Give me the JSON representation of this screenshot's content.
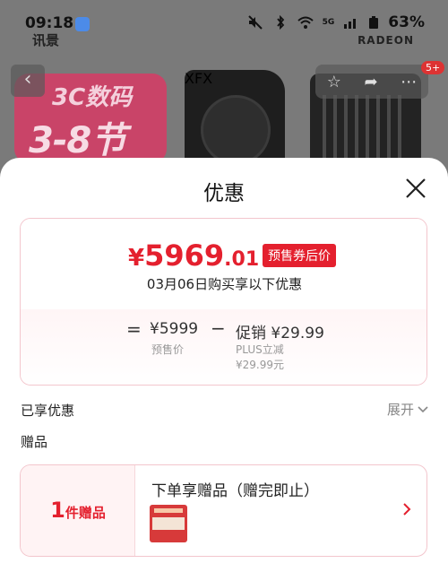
{
  "status_bar": {
    "time": "09:18",
    "battery": "63%",
    "network": "5G"
  },
  "background": {
    "brand_left": "讯景",
    "brand_right": "RADEON",
    "promo_line1": "3C数码",
    "promo_line2": "3-8节",
    "gpu_brand": "XFX",
    "badge_count": "5+"
  },
  "sheet": {
    "title": "优惠",
    "price": {
      "currency": "¥",
      "integer": "5969",
      "decimal": ".01",
      "tag": "预售券后价",
      "date_line": "03月06日购买享以下优惠"
    },
    "breakdown": {
      "equals": "=",
      "base_price": "¥5999",
      "base_label": "预售价",
      "minus": "−",
      "promo": "促销 ¥29.99",
      "promo_sub1": "PLUS立减",
      "promo_sub2": "¥29.99元"
    },
    "enjoyed_label": "已享优惠",
    "expand_label": "展开",
    "gift_section_label": "赠品",
    "gift": {
      "count_num": "1",
      "count_unit": "件赠品",
      "title": "下单享赠品（赠完即止）"
    }
  },
  "colors": {
    "accent": "#e4202e",
    "card_border": "#f3c6cd"
  }
}
